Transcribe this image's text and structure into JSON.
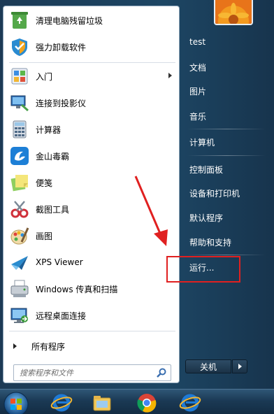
{
  "start_menu": {
    "programs": [
      {
        "label": "清理电脑残留垃圾",
        "icon": "recycle-icon"
      },
      {
        "label": "强力卸载软件",
        "icon": "uninstall-shield-icon"
      },
      {
        "label": "入门",
        "icon": "getting-started-icon",
        "has_submenu": true
      },
      {
        "label": "连接到投影仪",
        "icon": "projector-icon"
      },
      {
        "label": "计算器",
        "icon": "calculator-icon"
      },
      {
        "label": "金山毒霸",
        "icon": "duba-antivirus-icon"
      },
      {
        "label": "便笺",
        "icon": "sticky-notes-icon"
      },
      {
        "label": "截图工具",
        "icon": "snipping-tool-icon"
      },
      {
        "label": "画图",
        "icon": "paint-icon"
      },
      {
        "label": "XPS Viewer",
        "icon": "xps-viewer-icon"
      },
      {
        "label": "Windows 传真和扫描",
        "icon": "fax-scan-icon"
      },
      {
        "label": "远程桌面连接",
        "icon": "remote-desktop-icon"
      }
    ],
    "all_programs_label": "所有程序",
    "search_placeholder": "搜索程序和文件",
    "right_items": [
      {
        "label": "test"
      },
      {
        "label": "文档"
      },
      {
        "label": "图片"
      },
      {
        "label": "音乐"
      },
      {
        "label": "计算机"
      },
      {
        "label": "控制面板"
      },
      {
        "label": "设备和打印机"
      },
      {
        "label": "默认程序"
      },
      {
        "label": "帮助和支持"
      },
      {
        "label": "运行..."
      }
    ],
    "shutdown_label": "关机"
  },
  "taskbar": {
    "icons": [
      "start-orb-icon",
      "ie-icon",
      "explorer-icon",
      "chrome-icon",
      "ie-icon"
    ]
  },
  "colors": {
    "highlight_box": "#e02020",
    "annotation_arrow": "#e02020",
    "menu_text_right": "#ffffff"
  }
}
